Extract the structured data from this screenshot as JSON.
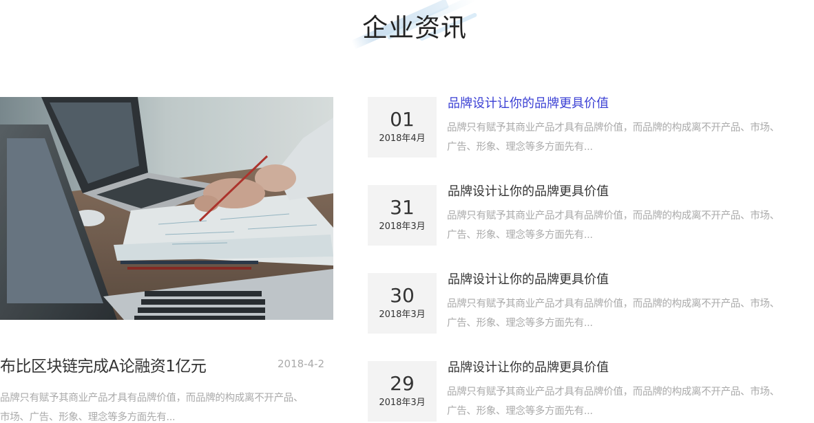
{
  "section": {
    "title": "企业资讯"
  },
  "featured": {
    "image": "office-laptop-desk-photo",
    "title": "布比区块链完成A论融资1亿元",
    "date": "2018-4-2",
    "summary_lines": [
      "品牌只有赋予其商业产品才具有品牌价值，而品牌的构成离不开产品、",
      "市场、广告、形象、理念等多方面先有..."
    ]
  },
  "news": [
    {
      "day": "01",
      "year_month": "2018年4月",
      "title": "品牌设计让你的品牌更具价值",
      "summary_lines": [
        "品牌只有赋予其商业产品才具有品牌价值，而品牌的构成离不开产品、市场、",
        "广告、形象、理念等多方面先有..."
      ],
      "title_color": "#3a3fd4"
    },
    {
      "day": "31",
      "year_month": "2018年3月",
      "title": "品牌设计让你的品牌更具价值",
      "summary_lines": [
        "品牌只有赋予其商业产品才具有品牌价值，而品牌的构成离不开产品、市场、",
        "广告、形象、理念等多方面先有..."
      ]
    },
    {
      "day": "30",
      "year_month": "2018年3月",
      "title": "品牌设计让你的品牌更具价值",
      "summary_lines": [
        "品牌只有赋予其商业产品才具有品牌价值，而品牌的构成离不开产品、市场、",
        "广告、形象、理念等多方面先有..."
      ]
    },
    {
      "day": "29",
      "year_month": "2018年3月",
      "title": "品牌设计让你的品牌更具价值",
      "summary_lines": [
        "品牌只有赋予其商业产品才具有品牌价值，而品牌的构成离不开产品、市场、",
        "广告、形象、理念等多方面先有..."
      ]
    }
  ],
  "colors": {
    "title_text": "#222222",
    "active_link": "#3a3fd4",
    "muted_text": "#aaaaaa",
    "date_box_bg": "#f3f3f3"
  }
}
